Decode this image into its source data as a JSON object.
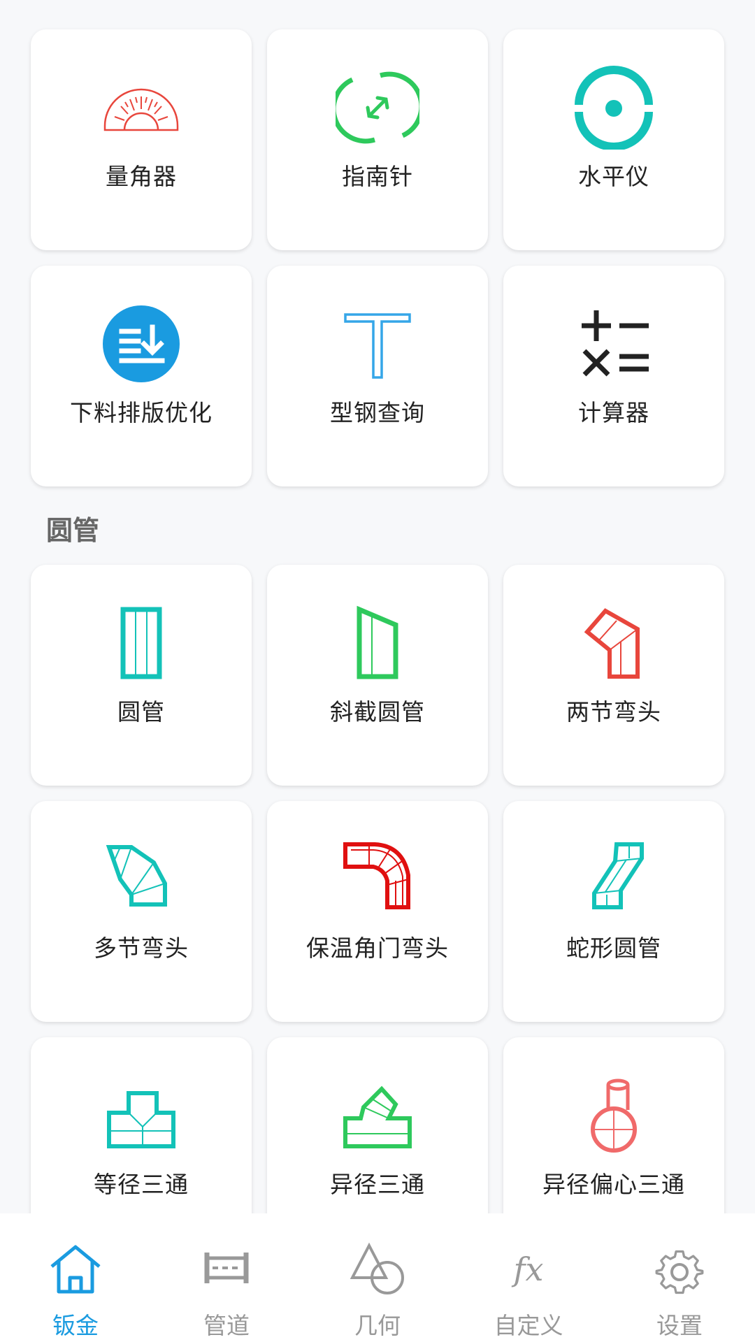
{
  "tools": [
    {
      "id": "protractor",
      "label": "量角器",
      "icon": "protractor-icon",
      "color": "#e8463c"
    },
    {
      "id": "compass",
      "label": "指南针",
      "icon": "compass-icon",
      "color": "#2ec95c"
    },
    {
      "id": "level",
      "label": "水平仪",
      "icon": "level-icon",
      "color": "#13c2b8"
    },
    {
      "id": "nesting",
      "label": "下料排版优化",
      "icon": "nesting-icon",
      "color": "#1a9be0"
    },
    {
      "id": "steel",
      "label": "型钢查询",
      "icon": "steel-profile-icon",
      "color": "#35a6e8"
    },
    {
      "id": "calculator",
      "label": "计算器",
      "icon": "calculator-icon",
      "color": "#222222"
    }
  ],
  "section": {
    "title": "圆管"
  },
  "pipes": [
    {
      "id": "round-pipe",
      "label": "圆管",
      "icon": "round-pipe-icon",
      "color": "#13c2b8"
    },
    {
      "id": "oblique-pipe",
      "label": "斜截圆管",
      "icon": "oblique-pipe-icon",
      "color": "#2ec95c"
    },
    {
      "id": "two-elbow",
      "label": "两节弯头",
      "icon": "two-section-elbow-icon",
      "color": "#e8463c"
    },
    {
      "id": "multi-elbow",
      "label": "多节弯头",
      "icon": "multi-section-elbow-icon",
      "color": "#13c2b8"
    },
    {
      "id": "insulated-elbow",
      "label": "保温角门弯头",
      "icon": "insulated-elbow-icon",
      "color": "#e01010"
    },
    {
      "id": "snake-pipe",
      "label": "蛇形圆管",
      "icon": "snake-pipe-icon",
      "color": "#13c2b8"
    },
    {
      "id": "equal-tee",
      "label": "等径三通",
      "icon": "equal-tee-icon",
      "color": "#13c2b8"
    },
    {
      "id": "reducing-tee",
      "label": "异径三通",
      "icon": "reducing-tee-icon",
      "color": "#2ec95c"
    },
    {
      "id": "eccentric-tee",
      "label": "异径偏心三通",
      "icon": "eccentric-tee-icon",
      "color": "#f06a6a"
    }
  ],
  "nav": [
    {
      "id": "sheet-metal",
      "label": "钣金",
      "icon": "home-icon",
      "active": true
    },
    {
      "id": "pipeline",
      "label": "管道",
      "icon": "pipeline-icon",
      "active": false
    },
    {
      "id": "geometry",
      "label": "几何",
      "icon": "geometry-icon",
      "active": false
    },
    {
      "id": "custom",
      "label": "自定义",
      "icon": "function-icon",
      "active": false
    },
    {
      "id": "settings",
      "label": "设置",
      "icon": "gear-icon",
      "active": false
    }
  ],
  "colors": {
    "accent": "#1a9be0",
    "inactive": "#999999",
    "background": "#f7f8fa"
  }
}
